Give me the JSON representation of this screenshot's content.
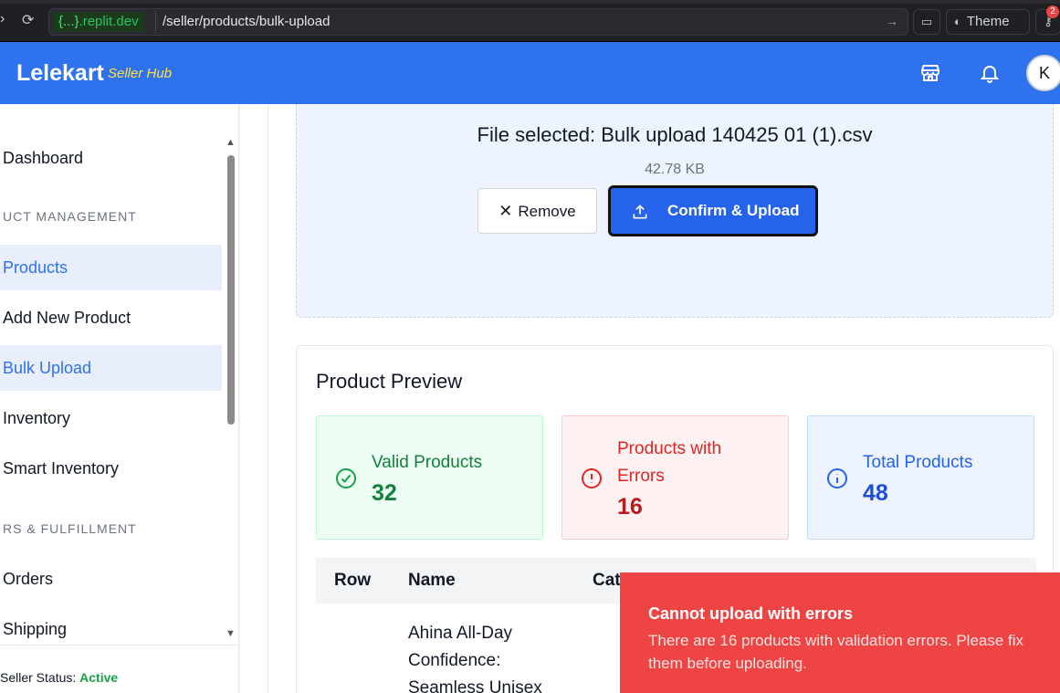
{
  "browser": {
    "host_prefix": "{...}",
    "host_suffix": ".replit.dev",
    "path": "/seller/products/bulk-upload",
    "theme_label": "Theme",
    "badge_count": "2"
  },
  "header": {
    "brand": "Lelekart",
    "brand_sub": "Seller Hub",
    "avatar_initial": "K"
  },
  "sidebar": {
    "items": [
      {
        "label": "Dashboard"
      },
      {
        "label": "Products"
      },
      {
        "label": "Add New Product"
      },
      {
        "label": "Bulk Upload"
      },
      {
        "label": "Inventory"
      },
      {
        "label": "Smart Inventory"
      },
      {
        "label": "Orders"
      },
      {
        "label": "Shipping"
      }
    ],
    "sections": [
      "UCT MANAGEMENT",
      "RS & FULFILLMENT"
    ],
    "seller_status_label": "Seller Status:",
    "seller_status_value": "Active"
  },
  "upload": {
    "file_selected": "File selected: Bulk upload 140425 01 (1).csv",
    "file_size": "42.78 KB",
    "remove_label": "Remove",
    "confirm_label": "Confirm & Upload"
  },
  "preview": {
    "title": "Product Preview",
    "valid_label": "Valid Products",
    "valid_value": "32",
    "errors_label_line1": "Products with",
    "errors_label_line2": "Errors",
    "errors_value": "16",
    "total_label": "Total Products",
    "total_value": "48",
    "columns": [
      "Row",
      "Name",
      "Cat"
    ],
    "first_row_name_lines": [
      "Ahina All-Day",
      "Confidence:",
      "Seamless Unisex"
    ]
  },
  "toast": {
    "title": "Cannot upload with errors",
    "body": "There are 16 products with validation errors. Please fix them before uploading."
  },
  "colors": {
    "primary": "#2e72f0",
    "success": "#15803d",
    "danger": "#ef4444"
  }
}
